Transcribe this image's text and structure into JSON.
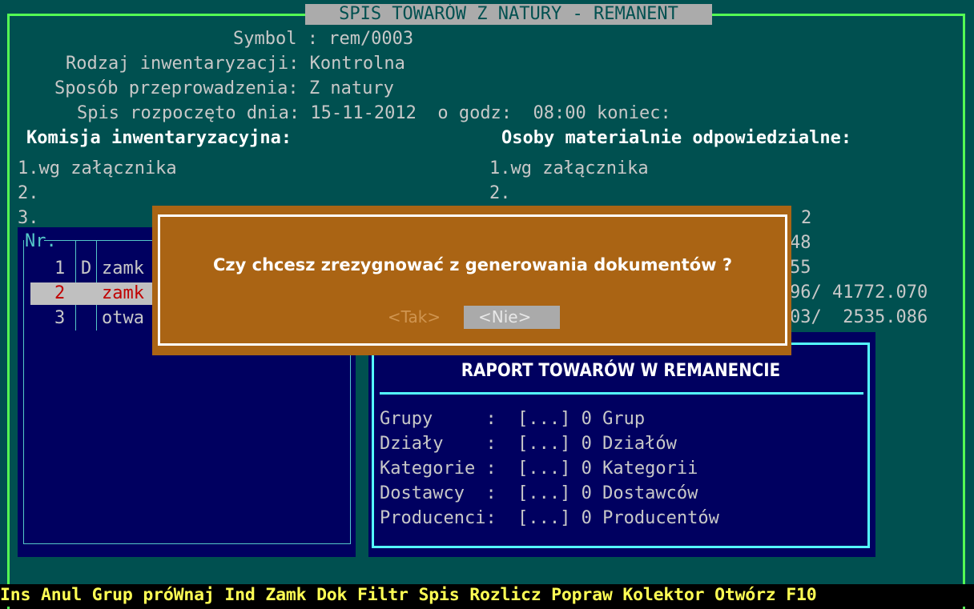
{
  "title": "SPIS TOWARÓW Z NATURY - REMANENT",
  "header": {
    "symbol": "Symbol : rem/0003",
    "rodzaj": "Rodzaj inwentaryzacji: Kontrolna",
    "sposob": "Sposób przeprowadzenia: Z natury",
    "spis": "Spis rozpoczęto dnia: 15-11-2012  o godz:  08:00 koniec:"
  },
  "komisja": {
    "label": "Komisja inwentaryzacyjna:",
    "items": [
      "1.wg załącznika",
      "2.",
      "3."
    ]
  },
  "osoby": {
    "label": "Osoby materialnie odpowiedzialne:",
    "items": [
      "1.wg załącznika",
      "2."
    ]
  },
  "list": {
    "header": "Nr.",
    "rows": [
      {
        "nr": "1",
        "flag": "D",
        "name": "zamk"
      },
      {
        "nr": "2",
        "flag": "",
        "name": "zamk"
      },
      {
        "nr": "3",
        "flag": "",
        "name": "otwa"
      }
    ]
  },
  "right_fragments": [
    "2",
    "48",
    "55",
    "96/ 41772.070",
    "03/  2535.086"
  ],
  "report": {
    "title": "RAPORT TOWARÓW W REMANENCIE",
    "rows": [
      "Grupy     :  [...] 0 Grup",
      "Działy    :  [...] 0 Działów",
      "Kategorie :  [...] 0 Kategorii",
      "Dostawcy  :  [...] 0 Dostawców",
      "Producenci:  [...] 0 Producentów"
    ]
  },
  "dialog": {
    "message": "Czy chcesz zrezygnować z generowania dokumentów ?",
    "yes": "<Tak>",
    "no": "<Nie>"
  },
  "fkeys": "Ins Anul Grup próWnaj Ind Zamk Dok Filtr Spis Rozlicz Popraw Kolektor Otwórz F10",
  "colors": {
    "background": "#005050",
    "frame": "#54ff54",
    "dialog": "#aa6414",
    "report_border": "#54ffff",
    "fkeys": "#ffff54"
  }
}
